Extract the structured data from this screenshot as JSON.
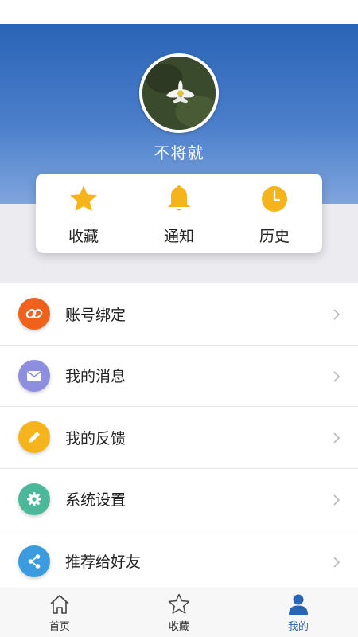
{
  "profile": {
    "username": "不将就"
  },
  "quick_actions": [
    {
      "label": "收藏",
      "icon": "star-icon"
    },
    {
      "label": "通知",
      "icon": "bell-icon"
    },
    {
      "label": "历史",
      "icon": "clock-icon"
    }
  ],
  "menu": [
    {
      "label": "账号绑定",
      "icon": "link-icon",
      "color": "#f0621c"
    },
    {
      "label": "我的消息",
      "icon": "mail-icon",
      "color": "#8e8ee0"
    },
    {
      "label": "我的反馈",
      "icon": "pencil-icon",
      "color": "#f5b41c"
    },
    {
      "label": "系统设置",
      "icon": "gear-icon",
      "color": "#4cb89a"
    },
    {
      "label": "推荐给好友",
      "icon": "share-icon",
      "color": "#3a9be0"
    }
  ],
  "tabbar": [
    {
      "label": "首页",
      "icon": "home-icon"
    },
    {
      "label": "收藏",
      "icon": "star-outline-icon"
    },
    {
      "label": "我的",
      "icon": "user-icon",
      "active": true
    }
  ],
  "colors": {
    "header_blue": "#2a64b5",
    "quick_icon_yellow": "#f5b41c",
    "active_tab": "#2a64b5"
  }
}
